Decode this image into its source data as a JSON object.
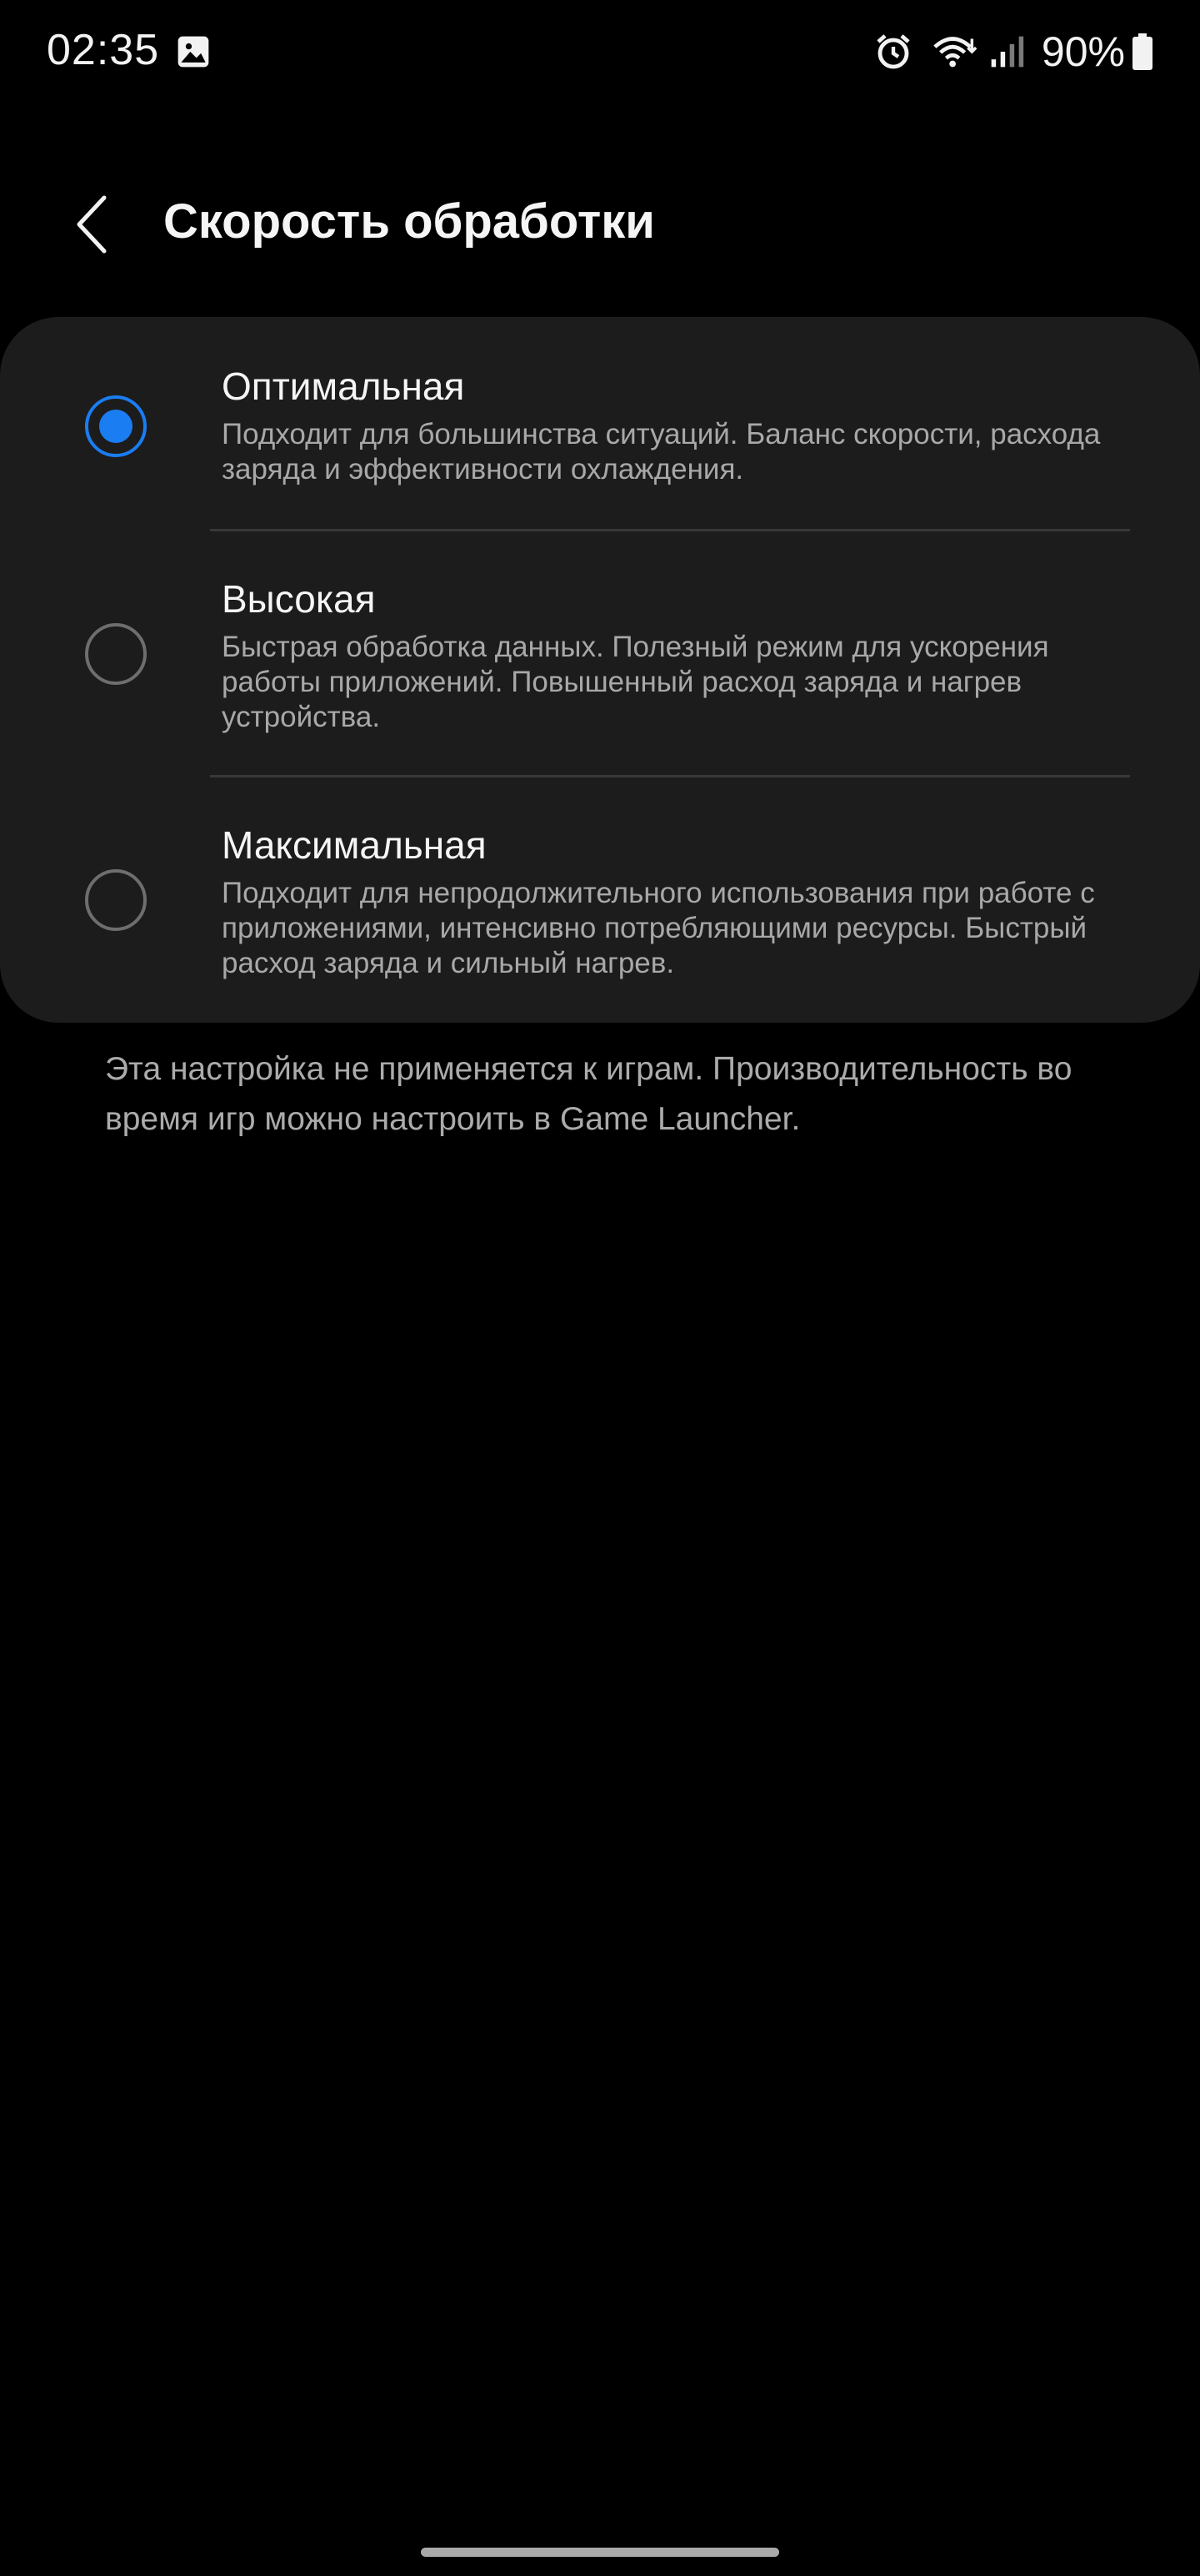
{
  "status_bar": {
    "time": "02:35",
    "battery": "90%",
    "icons": [
      "gallery-icon",
      "alarm-icon",
      "wifi-icon",
      "signal-icon",
      "battery-icon"
    ]
  },
  "header": {
    "back_icon": "chevron-left-icon",
    "title": "Скорость обработки"
  },
  "options": [
    {
      "title": "Оптимальная",
      "description": "Подходит для большинства ситуаций. Баланс скорости, расхода заряда и эффективности охлаждения.",
      "selected": true
    },
    {
      "title": "Высокая",
      "description": "Быстрая обработка данных. Полезный режим для ускорения работы приложений. Повышенный расход заряда и нагрев устройства.",
      "selected": false
    },
    {
      "title": "Максимальная",
      "description": "Подходит для непродолжительного использования при работе с приложениями, интенсивно потребляющими ресурсы. Быстрый расход заряда и сильный нагрев.",
      "selected": false
    }
  ],
  "note": "Эта настройка не применяется к играм. Производительность во время игр можно настроить в Game Launcher.",
  "colors": {
    "accent": "#1a7df2",
    "background": "#000000",
    "card": "#1c1c1c",
    "secondary_text": "#a8a8a8"
  }
}
